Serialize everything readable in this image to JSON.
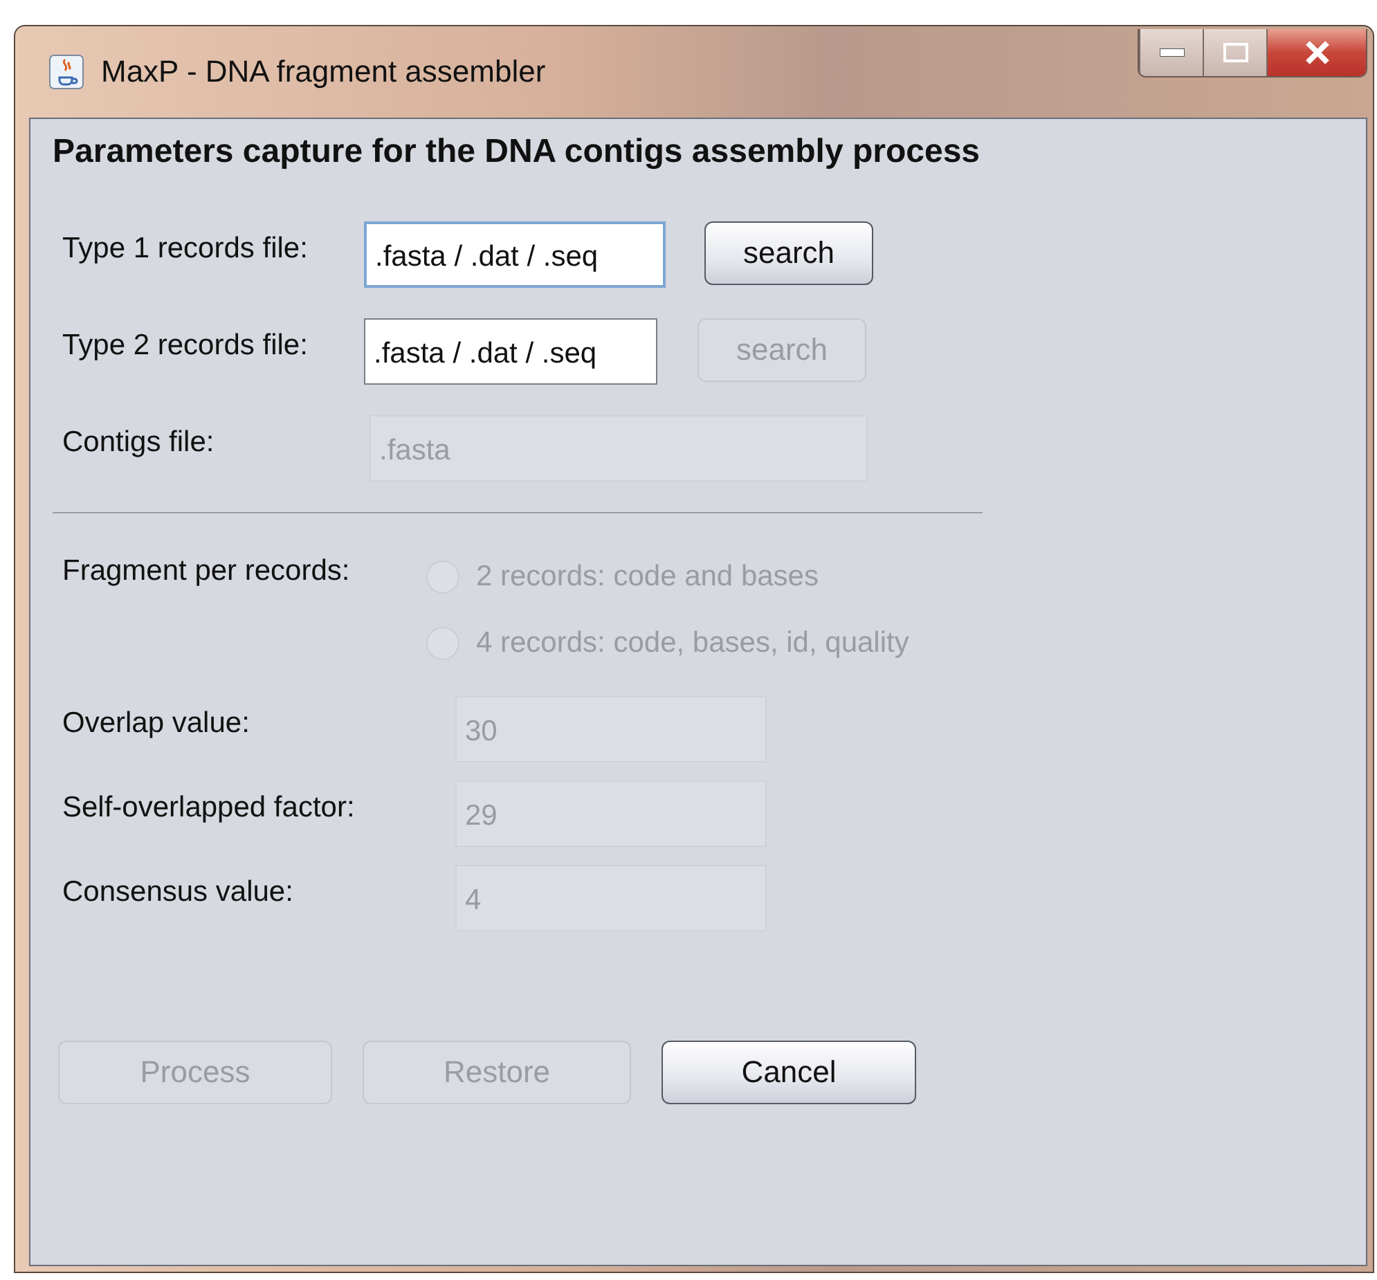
{
  "window": {
    "title": "MaxP - DNA fragment assembler"
  },
  "heading": "Parameters capture for the DNA contigs assembly process",
  "file_rows": [
    {
      "label": "Type 1 records file:",
      "value": ".fasta / .dat / .seq",
      "disabled": false,
      "focused": true,
      "button": {
        "label": "search",
        "disabled": false
      }
    },
    {
      "label": "Type 2 records file:",
      "value": ".fasta / .dat / .seq",
      "disabled": false,
      "focused": false,
      "button": {
        "label": "search",
        "disabled": true
      }
    },
    {
      "label": "Contigs file:",
      "value": ".fasta",
      "disabled": true,
      "focused": false
    }
  ],
  "fragment": {
    "label": "Fragment per records:",
    "options": [
      {
        "label": "2 records: code and bases",
        "selected": false,
        "disabled": true
      },
      {
        "label": "4 records: code, bases, id, quality",
        "selected": false,
        "disabled": true
      }
    ]
  },
  "params": [
    {
      "label": "Overlap value:",
      "value": "30",
      "disabled": true
    },
    {
      "label": "Self-overlapped factor:",
      "value": "29",
      "disabled": true
    },
    {
      "label": "Consensus value:",
      "value": "4",
      "disabled": true
    }
  ],
  "buttons": [
    {
      "label": "Process",
      "disabled": true
    },
    {
      "label": "Restore",
      "disabled": true
    },
    {
      "label": "Cancel",
      "disabled": false
    }
  ]
}
